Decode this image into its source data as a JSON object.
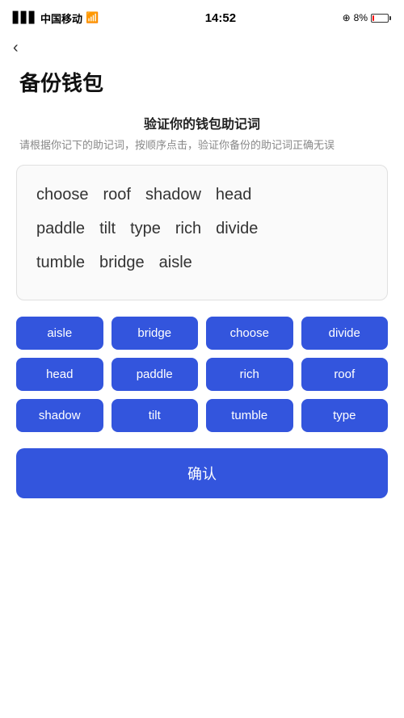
{
  "statusBar": {
    "carrier": "中国移动",
    "wifi": "wifi",
    "time": "14:52",
    "battery": "8%"
  },
  "back": "‹",
  "pageTitle": "备份钱包",
  "sectionTitle": "验证你的钱包助记词",
  "sectionDesc": "请根据你记下的助记词，按顺序点击，验证你备份的助记词正确无误",
  "displayWords": {
    "row1": [
      "choose",
      "roof",
      "shadow",
      "head"
    ],
    "row2": [
      "paddle",
      "tilt",
      "type",
      "rich",
      "divide"
    ],
    "row3": [
      "tumble",
      "bridge",
      "aisle"
    ]
  },
  "wordButtons": [
    "aisle",
    "bridge",
    "choose",
    "divide",
    "head",
    "paddle",
    "rich",
    "roof",
    "shadow",
    "tilt",
    "tumble",
    "type"
  ],
  "confirmLabel": "确认"
}
